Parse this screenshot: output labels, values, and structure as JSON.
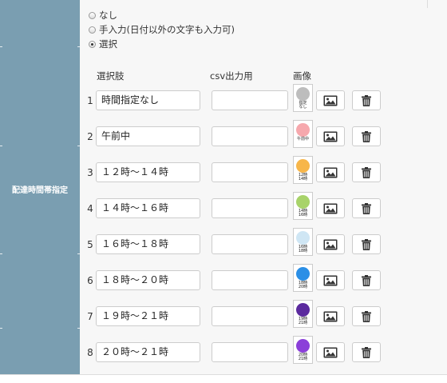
{
  "sidebar": {
    "label": "配達時間帯指定"
  },
  "radios": [
    {
      "label": "なし",
      "selected": false
    },
    {
      "label": "手入力(日付以外の文字も入力可)",
      "selected": false
    },
    {
      "label": "選択",
      "selected": true
    }
  ],
  "headers": {
    "choice": "選択肢",
    "csv": "csv出力用",
    "image": "画像"
  },
  "rows": [
    {
      "num": "1",
      "value": "時間指定なし",
      "csv": "",
      "thumb_lines": [
        "指定",
        "なし"
      ],
      "color": "#bdbdbd",
      "icon": "circle-gray-icon"
    },
    {
      "num": "2",
      "value": "午前中",
      "csv": "",
      "thumb_lines": [
        "午前中",
        ""
      ],
      "color": "#f6a8ad",
      "icon": "circle-pink-icon"
    },
    {
      "num": "3",
      "value": "１２時～１４時",
      "csv": "",
      "thumb_lines": [
        "12時",
        "14時"
      ],
      "color": "#f7b64a",
      "icon": "circle-orange-icon"
    },
    {
      "num": "4",
      "value": "１４時～１６時",
      "csv": "",
      "thumb_lines": [
        "14時",
        "16時"
      ],
      "color": "#a8d36a",
      "icon": "circle-green-icon"
    },
    {
      "num": "5",
      "value": "１６時～１８時",
      "csv": "",
      "thumb_lines": [
        "16時",
        "18時"
      ],
      "color": "#cfe6f4",
      "icon": "circle-lightblue-icon"
    },
    {
      "num": "6",
      "value": "１８時～２０時",
      "csv": "",
      "thumb_lines": [
        "18時",
        "20時"
      ],
      "color": "#2b8fe6",
      "icon": "circle-blue-icon"
    },
    {
      "num": "7",
      "value": "１９時～２１時",
      "csv": "",
      "thumb_lines": [
        "19時",
        "21時"
      ],
      "color": "#5b2a9e",
      "icon": "circle-purple-icon"
    },
    {
      "num": "8",
      "value": "２０時～２１時",
      "csv": "",
      "thumb_lines": [
        "20時",
        "21時"
      ],
      "color": "#8b3fd9",
      "icon": "circle-violet-icon"
    }
  ]
}
